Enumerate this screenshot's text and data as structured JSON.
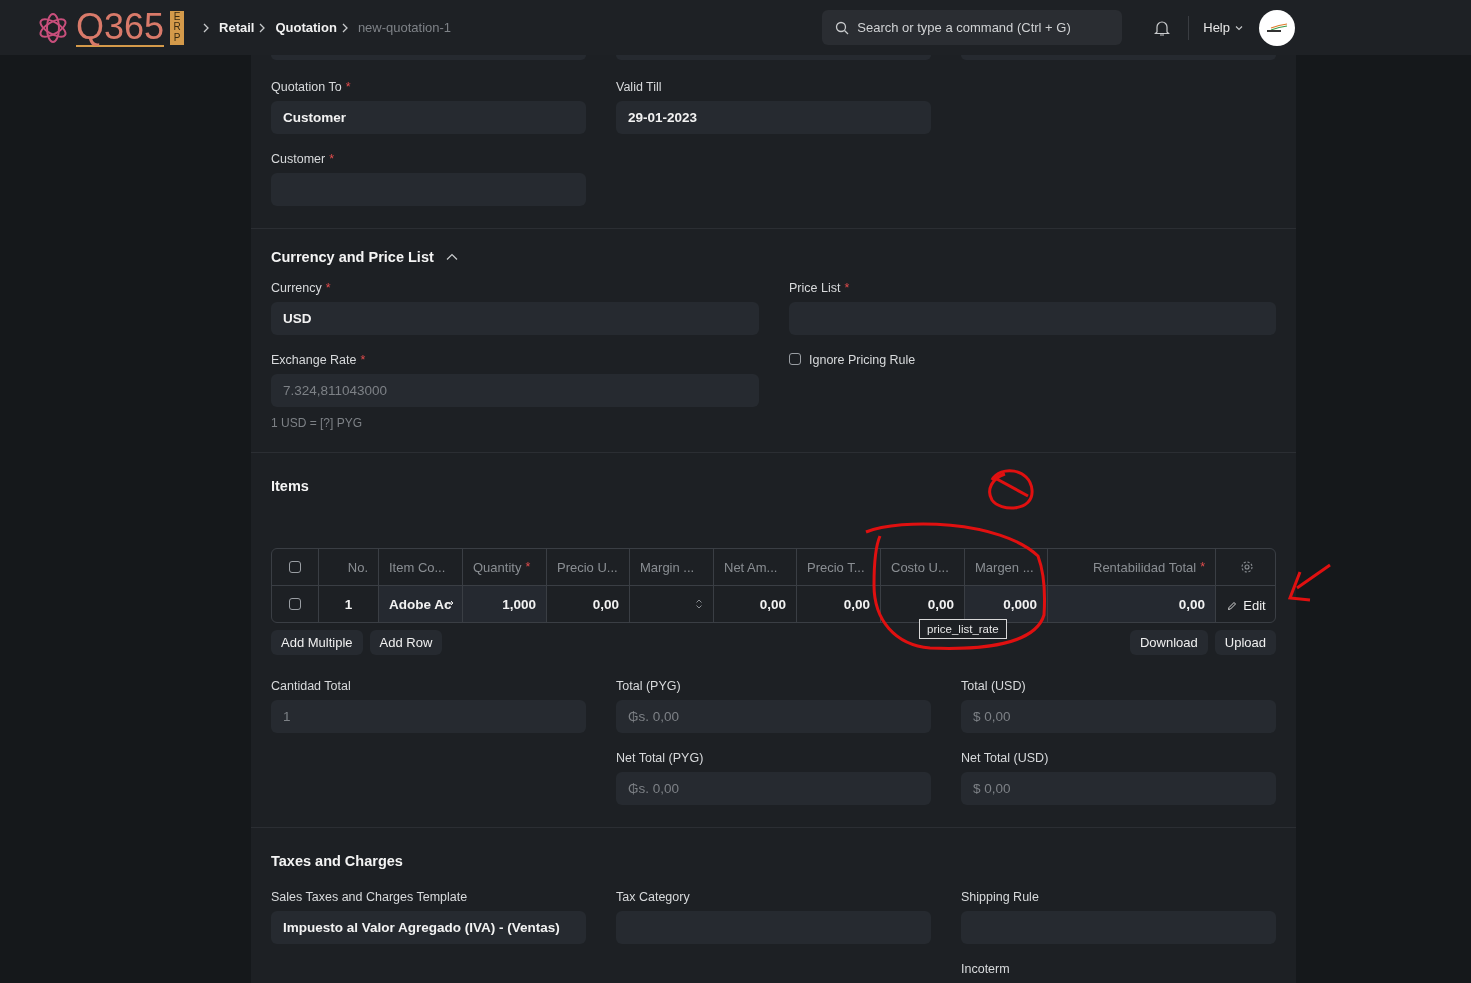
{
  "navbar": {
    "logo_text": "Q365",
    "logo_badge": "ERP",
    "breadcrumbs": [
      {
        "label": "Retail",
        "current": false
      },
      {
        "label": "Quotation",
        "current": false
      },
      {
        "label": "new-quotation-1",
        "current": true
      }
    ],
    "search": {
      "placeholder": "Search or type a command (Ctrl + G)"
    },
    "help": "Help"
  },
  "details": {
    "fields": [
      {
        "label": "Quotation To",
        "mark": "*",
        "value": "Customer",
        "read_only": false
      },
      {
        "label": "Valid Till",
        "value": "29-01-2023",
        "read_only": false
      },
      {
        "label": "Customer",
        "mark": "*"
      }
    ]
  },
  "currency_section": {
    "title": "Currency and Price List",
    "expanded": true,
    "currency": {
      "label": "Currency",
      "mark": "*",
      "value": "USD",
      "read_only": false
    },
    "price_list": {
      "label": "Price List",
      "mark": "*"
    },
    "exchange_rate": {
      "label": "Exchange Rate",
      "mark": "*",
      "value": "7.324,811043000",
      "read_only": true,
      "description": "1 USD = [?] PYG"
    },
    "ignore_pricing_rule": {
      "label": "Ignore Pricing Rule",
      "checked": false
    }
  },
  "items_section": {
    "title": "Items",
    "columns": [
      {
        "label": "No."
      },
      {
        "label": "Item Co..."
      },
      {
        "label": "Quantity",
        "mark": "*"
      },
      {
        "label": "Precio U..."
      },
      {
        "label": "Margin ..."
      },
      {
        "label": "Net Am..."
      },
      {
        "label": "Precio T..."
      },
      {
        "label": "Costo U..."
      },
      {
        "label": "Margen ..."
      },
      {
        "label": "Rentabilidad Total",
        "mark": "*"
      }
    ],
    "all_selected": false,
    "rows": [
      {
        "selected": false,
        "cells": [
          {
            "kind": "index",
            "text": "1",
            "editable": false
          },
          {
            "kind": "link",
            "text": "Adobe Ac",
            "editable": true
          },
          {
            "kind": "number",
            "text": "1,000",
            "editable": true
          },
          {
            "kind": "number",
            "text": "0,00",
            "editable": false
          },
          {
            "kind": "select",
            "editable": false
          },
          {
            "kind": "number",
            "text": "0,00",
            "editable": false
          },
          {
            "kind": "number",
            "text": "0,00",
            "editable": false
          },
          {
            "kind": "number",
            "text": "0,00",
            "editable": false
          },
          {
            "kind": "number",
            "text": "0,000",
            "editable": true
          },
          {
            "kind": "number",
            "text": "0,00",
            "editable": true
          }
        ],
        "edit": "Edit"
      }
    ],
    "tooltip": "price_list_rate",
    "left_buttons": [
      "Add Multiple",
      "Add Row"
    ],
    "right_buttons": [
      "Download",
      "Upload"
    ]
  },
  "totals": {
    "total_qty": {
      "label": "Cantidad Total",
      "value": "1",
      "read_only": true
    },
    "total_company": {
      "label": "Total (PYG)",
      "value": "₲s. 0,00",
      "read_only": true
    },
    "total": {
      "label": "Total (USD)",
      "value": "$ 0,00",
      "read_only": true
    },
    "net_total_company": {
      "label": "Net Total (PYG)",
      "value": "₲s. 0,00",
      "read_only": true
    },
    "net_total": {
      "label": "Net Total (USD)",
      "value": "$ 0,00",
      "read_only": true
    }
  },
  "taxes_section": {
    "title": "Taxes and Charges",
    "fields": [
      {
        "label": "Sales Taxes and Charges Template",
        "value": "Impuesto al Valor Agregado (IVA) - (Ventas)",
        "read_only": false
      },
      {
        "label": "Tax Category"
      },
      {
        "label": "Shipping Rule"
      }
    ],
    "extra_label": "Incoterm"
  }
}
